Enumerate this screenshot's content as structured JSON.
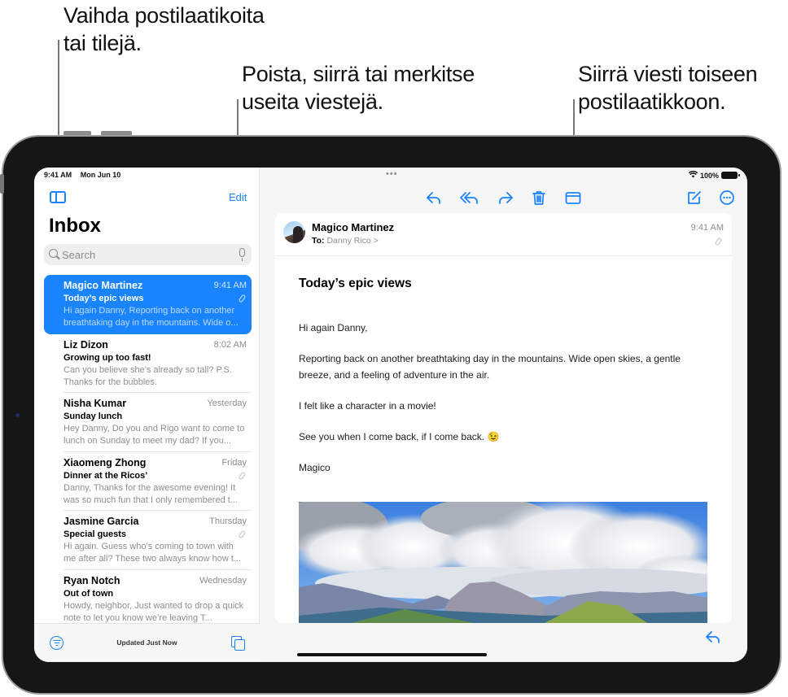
{
  "callouts": {
    "mailboxes": [
      "Vaihda postilaatikoita",
      "tai tilejä."
    ],
    "edit": [
      "Poista, siirrä tai merkitse",
      "useita viestejä."
    ],
    "move": [
      "Siirrä viesti toiseen",
      "postilaatikkoon."
    ]
  },
  "status_bar": {
    "time": "9:41 AM",
    "date": "Mon Jun 10",
    "battery": "100%",
    "grabber": "•••"
  },
  "sidebar": {
    "edit_label": "Edit",
    "title": "Inbox",
    "search_placeholder": "Search",
    "footer_status": "Updated Just Now",
    "messages": [
      {
        "sender": "Magico Martinez",
        "time": "9:41 AM",
        "subject": "Today’s epic views",
        "preview": "Hi again Danny, Reporting back on another breathtaking day in the mountains. Wide o...",
        "has_attachment": true,
        "selected": true
      },
      {
        "sender": "Liz Dizon",
        "time": "8:02 AM",
        "subject": "Growing up too fast!",
        "preview": "Can you believe she’s already so tall? P.S. Thanks for the bubbles.",
        "has_attachment": false,
        "selected": false
      },
      {
        "sender": "Nisha Kumar",
        "time": "Yesterday",
        "subject": "Sunday lunch",
        "preview": "Hey Danny, Do you and Rigo want to come to lunch on Sunday to meet my dad? If you...",
        "has_attachment": false,
        "selected": false
      },
      {
        "sender": "Xiaomeng Zhong",
        "time": "Friday",
        "subject": "Dinner at the Ricos’",
        "preview": "Danny, Thanks for the awesome evening! It was so much fun that I only remembered t...",
        "has_attachment": true,
        "selected": false
      },
      {
        "sender": "Jasmine Garcia",
        "time": "Thursday",
        "subject": "Special guests",
        "preview": "Hi again. Guess who’s coming to town with me after all? These two always know how t...",
        "has_attachment": true,
        "selected": false
      },
      {
        "sender": "Ryan Notch",
        "time": "Wednesday",
        "subject": "Out of town",
        "preview": "Howdy, neighbor, Just wanted to drop a quick note to let you know we’re leaving T...",
        "has_attachment": false,
        "selected": false
      }
    ]
  },
  "toolbar": {
    "icons": [
      "reply-icon",
      "reply-all-icon",
      "forward-icon",
      "trash-icon",
      "move-to-folder-icon",
      "compose-icon",
      "more-icon"
    ]
  },
  "message": {
    "from": "Magico Martinez",
    "to_label": "To:",
    "to": "Danny Rico >",
    "time": "9:41 AM",
    "subject": "Today’s epic views",
    "body": [
      "Hi again Danny,",
      "Reporting back on another breathtaking day in the mountains. Wide open skies, a gentle breeze, and a feeling of adventure in the air.",
      "I felt like a character in a movie!",
      "See you when I come back, if I come back. 😉",
      "Magico"
    ],
    "attachment_alt": "Mountain landscape under cloudy blue sky"
  },
  "colors": {
    "accent": "#1a84ff"
  }
}
